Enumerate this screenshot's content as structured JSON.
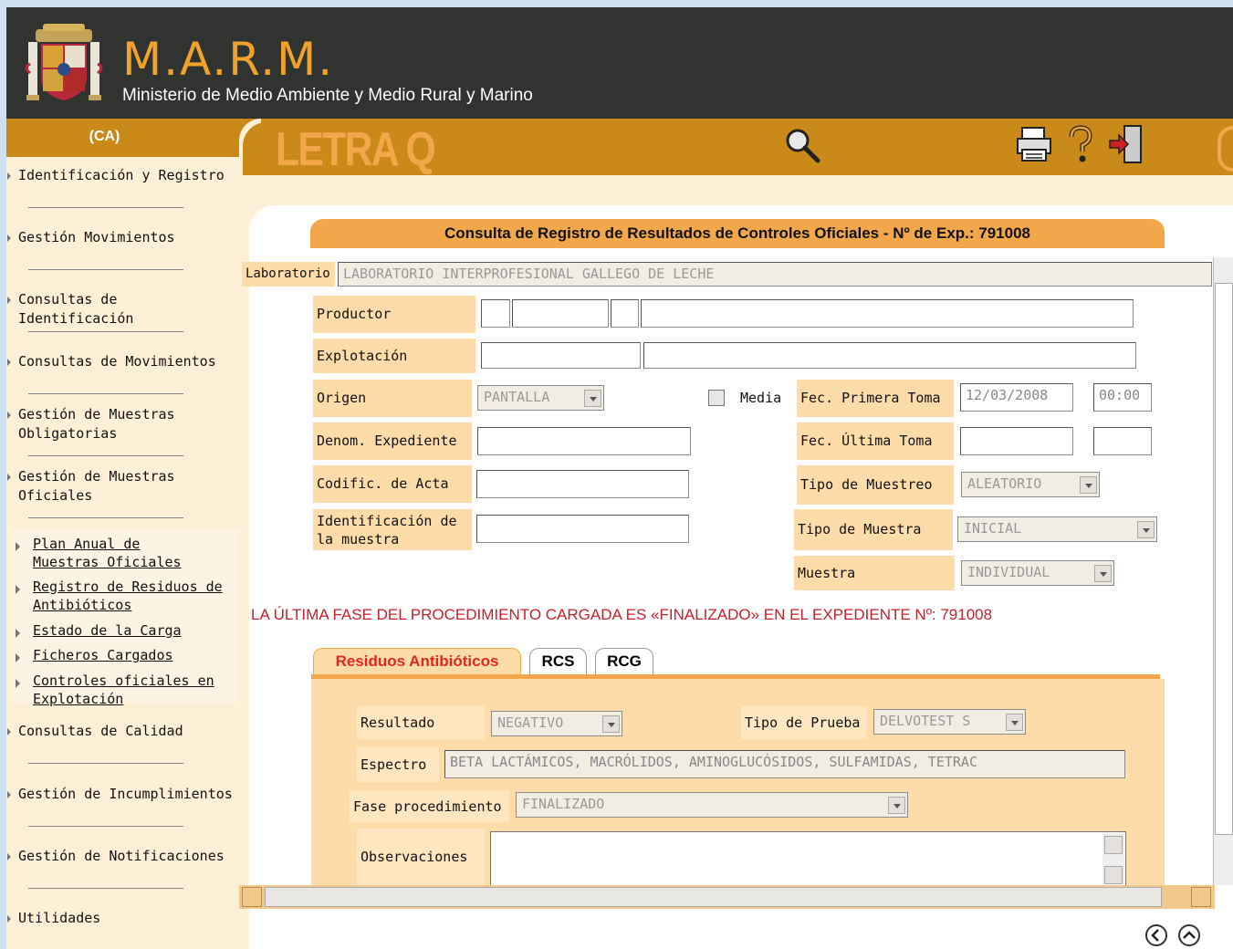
{
  "header": {
    "brand": "M.A.R.M.",
    "subtitle": "Ministerio de Medio Ambiente y Medio Rural y Marino"
  },
  "nav": {
    "heading": "(CA)",
    "items": [
      "Identificación y Registro",
      "Gestión Movimientos",
      "Consultas de Identificación",
      "Consultas de Movimientos",
      "Gestión de Muestras Obligatorias",
      "Gestión de Muestras Oficiales"
    ],
    "subitems": [
      "Plan Anual de Muestras Oficiales",
      "Registro de Residuos de Antibióticos",
      "Estado de la Carga",
      "Ficheros Cargados",
      "Controles oficiales en Explotación"
    ],
    "items_after": [
      "Consultas de Calidad",
      "Gestión de Incumplimientos",
      "Gestión de Notificaciones",
      "Utilidades"
    ]
  },
  "topbar": {
    "title": "LETRA Q",
    "icons": [
      "search-icon",
      "print-icon",
      "help-icon",
      "exit-icon"
    ],
    "accent": "#c98a1a",
    "title_color": "#f2a84a"
  },
  "form": {
    "heading": "Consulta de Registro de Resultados de Controles Oficiales - Nº de Exp.: 791008",
    "laboratorio_label": "Laboratorio",
    "laboratorio_value": "LABORATORIO INTERPROFESIONAL GALLEGO DE LECHE",
    "productor_label": "Productor",
    "explotacion_label": "Explotación",
    "origen_label": "Origen",
    "origen_value": "PANTALLA",
    "media_label": "Media",
    "fec_primera_label": "Fec. Primera Toma",
    "fec_primera_date": "12/03/2008",
    "fec_primera_time": "00:00",
    "denom_label": "Denom. Expediente",
    "fec_ultima_label": "Fec. Última Toma",
    "codific_label": "Codific. de Acta",
    "tipo_muestreo_label": "Tipo de Muestreo",
    "tipo_muestreo_value": "ALEATORIO",
    "identificacion_label": "Identificación de la muestra",
    "tipo_muestra_label": "Tipo de Muestra",
    "tipo_muestra_value": "INICIAL",
    "muestra_label": "Muestra",
    "muestra_value": "INDIVIDUAL",
    "warning": "LA ÚLTIMA FASE DEL PROCEDIMIENTO CARGADA ES «FINALIZADO» EN EL EXPEDIENTE Nº: 791008",
    "warning_color": "#c8202a"
  },
  "tabs": [
    {
      "label": "Residuos Antibióticos",
      "active": true
    },
    {
      "label": "RCS",
      "active": false
    },
    {
      "label": "RCG",
      "active": false
    }
  ],
  "tab_body": {
    "resultado_label": "Resultado",
    "resultado_value": "NEGATIVO",
    "tipo_prueba_label": "Tipo de Prueba",
    "tipo_prueba_value": "DELVOTEST S",
    "espectro_label": "Espectro",
    "espectro_value": "BETA LACTÁMICOS, MACRÓLIDOS, AMINOGLUCÓSIDOS, SULFAMIDAS, TETRAC",
    "fase_label": "Fase procedimiento",
    "fase_value": "FINALIZADO",
    "observaciones_label": "Observaciones"
  }
}
